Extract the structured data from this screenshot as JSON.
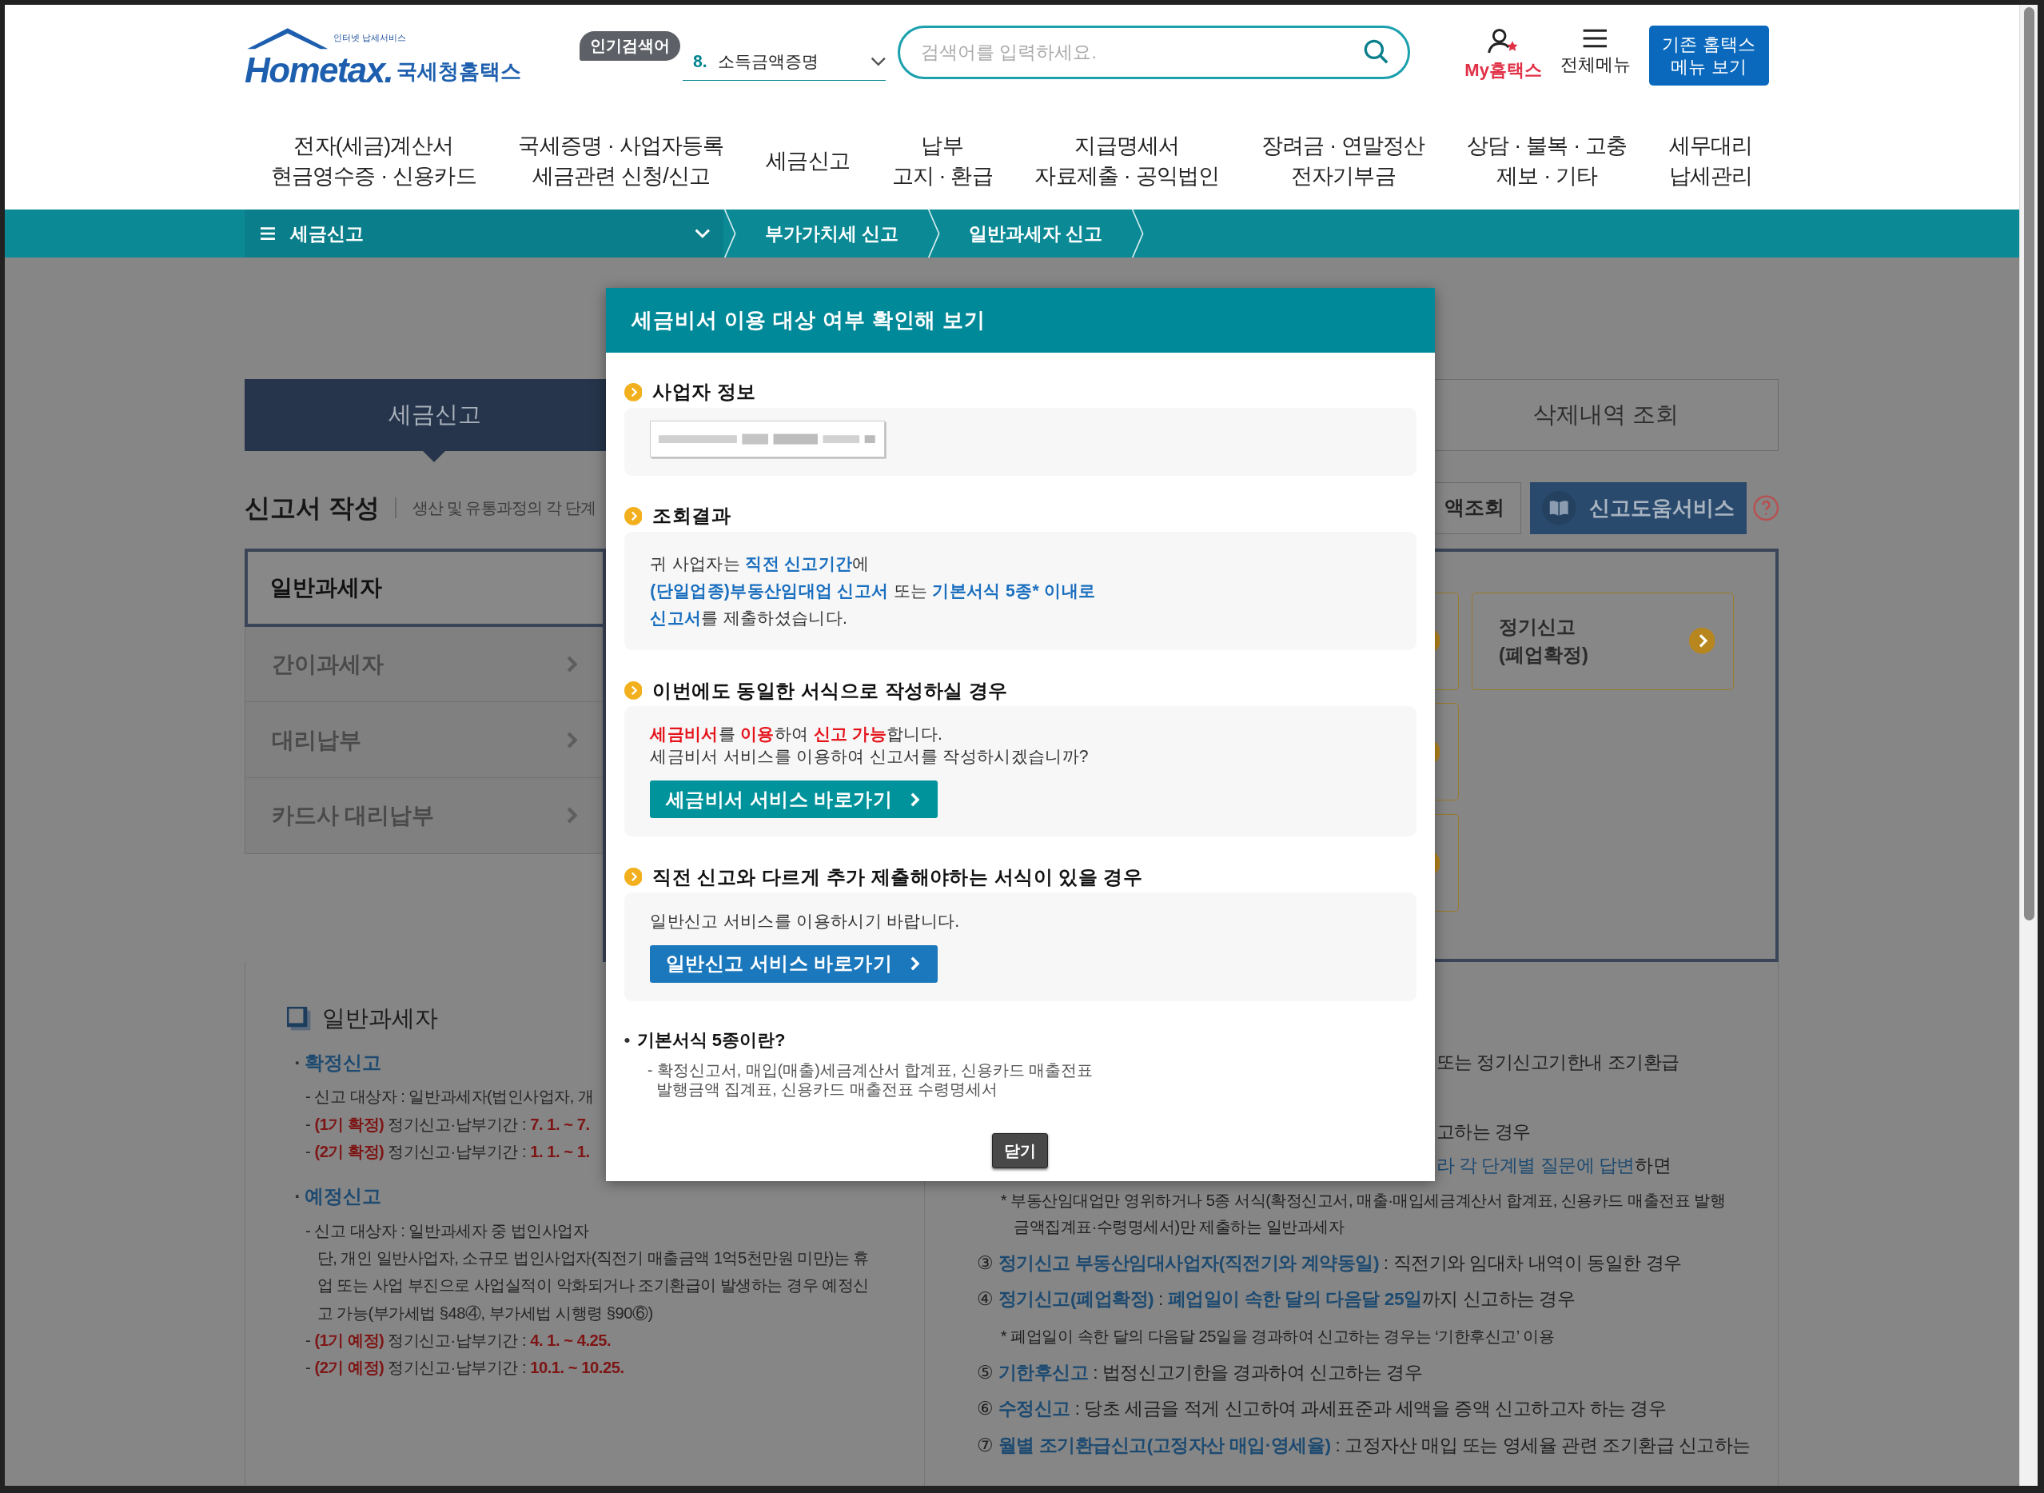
{
  "header": {
    "logo": {
      "tagline": "인터넷 납세서비스",
      "wordmark": "Hometax.",
      "name": "국세청홈택스"
    },
    "popular": {
      "badge": "인기검색어",
      "rank": "8.",
      "term": "소득금액증명"
    },
    "search": {
      "placeholder": "검색어를 입력하세요."
    },
    "my_link": "My홈택스",
    "all_menu": "전체메뉴",
    "legacy_button": "기존 홈택스\n메뉴 보기"
  },
  "nav": [
    {
      "lines": [
        "전자(세금)계산서",
        "현금영수증 · 신용카드"
      ]
    },
    {
      "lines": [
        "국세증명 · 사업자등록",
        "세금관련 신청/신고"
      ]
    },
    {
      "lines": [
        "세금신고"
      ]
    },
    {
      "lines": [
        "납부",
        "고지 · 환급"
      ]
    },
    {
      "lines": [
        "지급명세서",
        "자료제출 · 공익법인"
      ]
    },
    {
      "lines": [
        "장려금 · 연말정산",
        "전자기부금"
      ]
    },
    {
      "lines": [
        "상담 · 불복 · 고충",
        "제보 · 기타"
      ]
    },
    {
      "lines": [
        "세무대리",
        "납세관리"
      ]
    }
  ],
  "breadcrumb": [
    {
      "label": "세금신고",
      "kind": "menu"
    },
    {
      "label": "부가가치세 신고",
      "kind": "crumb"
    },
    {
      "label": "일반과세자 신고",
      "kind": "crumb"
    }
  ],
  "tabs": [
    {
      "label": "세금신고",
      "selected": true
    },
    {
      "label": "삭제내역 조회",
      "selected": false
    }
  ],
  "section_heading": {
    "title": "신고서 작성",
    "description": "생산 및 유통과정의 각 단계"
  },
  "tools": {
    "lookup": "액조회",
    "help_service": "신고도움서비스"
  },
  "sidebar": [
    {
      "label": "일반과세자",
      "selected": true
    },
    {
      "label": "간이과세자",
      "selected": false
    },
    {
      "label": "대리납부",
      "selected": false
    },
    {
      "label": "카드사 대리납부",
      "selected": false
    }
  ],
  "cards": [
    {
      "kind": "covered"
    },
    {
      "kind": "titled",
      "title": "정기신고\n(폐업확정)"
    },
    {
      "kind": "covered"
    },
    {
      "kind": "covered"
    }
  ],
  "info_left": {
    "title": "일반과세자",
    "groups": [
      {
        "bullet": "▪",
        "title": "확정신고",
        "lines": [
          "- 신고 대상자 : 일반과세자(법인사업자, 개",
          "- **(1기 확정)** 정기신고·납부기간 : **7. 1. ~ 7.**",
          "- **(2기 확정)** 정기신고·납부기간 : **1. 1. ~ 1.**"
        ]
      },
      {
        "bullet": "▪",
        "title": "예정신고",
        "lines": [
          "- 신고 대상자 : 일반과세자 중 법인사업자\n  단, 개인 일반사업자, 소규모 법인사업자(직전기 매출금액 1억5천만원 미만)는 휴업 또는 사업 부진으로 사업실적이 악화되거나 조기환급이 발생하는 경우 예정신고 가능(부가세법 §48④, 부가세법 시행령 §90⑥)",
          "- **(1기 예정)** 정기신고·납부기간 : **4. 1. ~ 4.25.**",
          "- **(2기 예정)** 정기신고·납부기간 : **10.1. ~ 10.25.**"
        ]
      }
    ]
  },
  "info_right": [
    {
      "kind": "fragment",
      "text": "또는 정기신고기한내 조기환급"
    },
    {
      "kind": "fragment",
      "text": "고하는 경우"
    },
    {
      "kind": "fragment",
      "text": "**라 각 단계별 질문에 답변**하면"
    },
    {
      "kind": "note",
      "text": "* 부동산임대업만 영위하거나 5종 서식(확정신고서, 매출·매입세금계산서 합계표, 신용카드 매출전표 발행금액집계표·수령명세서)만 제출하는 일반과세자"
    },
    {
      "kind": "item",
      "text": "③ **정기신고 부동산임대사업자(직전기와 계약동일)** : 직전기와 임대차 내역이 동일한 경우"
    },
    {
      "kind": "item",
      "text": "④ **정기신고(폐업확정)** : **폐업일이 속한 달의 다음달 25일**까지 신고하는 경우"
    },
    {
      "kind": "note",
      "text": "* 폐업일이 속한 달의 다음달 25일을 경과하여 신고하는 경우는 ‘기한후신고’ 이용"
    },
    {
      "kind": "item",
      "text": "⑤ **기한후신고** : 법정신고기한을 경과하여 신고하는 경우"
    },
    {
      "kind": "item",
      "text": "⑥ **수정신고** : 당초 세금을 적게 신고하여 과세표준과 세액을 증액 신고하고자 하는 경우"
    },
    {
      "kind": "item",
      "text": "⑦ **월별 조기환급신고(고정자산 매입·영세율)** : 고정자산 매입 또는 영세율 관련 조기환급 신고하는"
    }
  ],
  "modal": {
    "title": "세금비서 이용 대상 여부 확인해 보기",
    "sections": [
      {
        "kind": "field",
        "heading": "사업자 정보"
      },
      {
        "kind": "result",
        "heading": "조회결과",
        "text": "귀 사업자는 **직전 신고기간**에\n**(단일업종)부동산임대업 신고서** 또는 **기본서식 5종* 이내로\n신고서**를 제출하셨습니다."
      },
      {
        "kind": "recommend",
        "heading": "이번에도 동일한 서식으로 작성하실 경우",
        "text": "**세금비서**를 **이용**하여 **신고 가능**합니다.\n세금비서 서비스를 이용하여 신고서를 작성하시겠습니까?",
        "button": "세금비서 서비스 바로가기"
      },
      {
        "kind": "alternative",
        "heading": "직전 신고와 다르게 추가 제출해야하는 서식이 있을 경우",
        "text": "일반신고 서비스를 이용하시기 바랍니다.",
        "button": "일반신고 서비스 바로가기"
      }
    ],
    "note_bullet": "•",
    "note_title": "기본서식 5종이란?",
    "note_text": "- 확정신고서, 매입(매출)세금계산서 합계표, 신용카드 매출전표\n  발행금액 집계표, 신용카드 매출전표 수령명세서",
    "close": "닫기"
  }
}
